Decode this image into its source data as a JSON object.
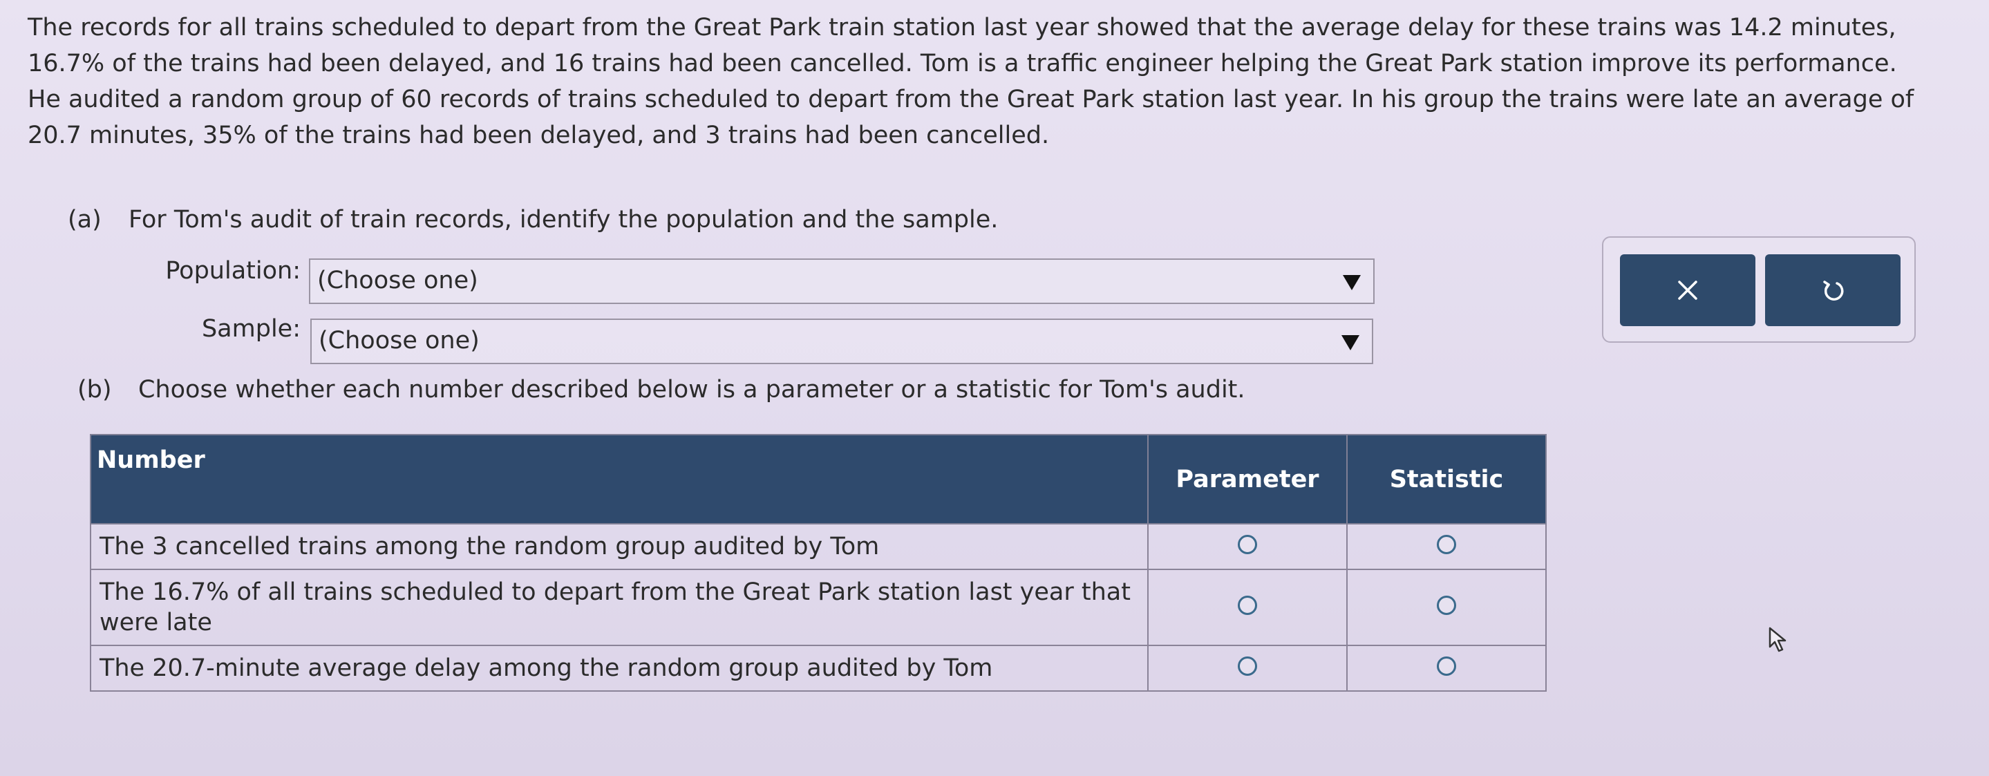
{
  "problem": {
    "text": "The records for all trains scheduled to depart from the Great Park train station last year showed that the average delay for these trains was 14.2 minutes, 16.7% of the trains had been delayed, and 16 trains had been cancelled. Tom is a traffic engineer helping the Great Park station improve its performance. He audited a random group of 60 records of trains scheduled to depart from the Great Park station last year. In his group the trains were late an average of 20.7 minutes, 35% of the trains had been delayed, and 3 trains had been cancelled."
  },
  "part_a": {
    "label": "(a)",
    "prompt": "For Tom's audit of train records, identify the population and the sample.",
    "population_label": "Population:",
    "population_value": "(Choose one)",
    "sample_label": "Sample:",
    "sample_value": "(Choose one)"
  },
  "part_b": {
    "label": "(b)",
    "prompt": "Choose whether each number described below is a parameter or a statistic for Tom's audit."
  },
  "table": {
    "headers": [
      "Number",
      "Parameter",
      "Statistic"
    ],
    "rows": [
      "The 3 cancelled trains among the random group audited by Tom",
      "The 16.7% of all trains scheduled to depart from the Great Park station last year that were late",
      "The 20.7-minute average delay among the random group audited by Tom"
    ]
  },
  "buttons": {
    "close_icon": "x-icon",
    "undo_icon": "undo-icon"
  }
}
